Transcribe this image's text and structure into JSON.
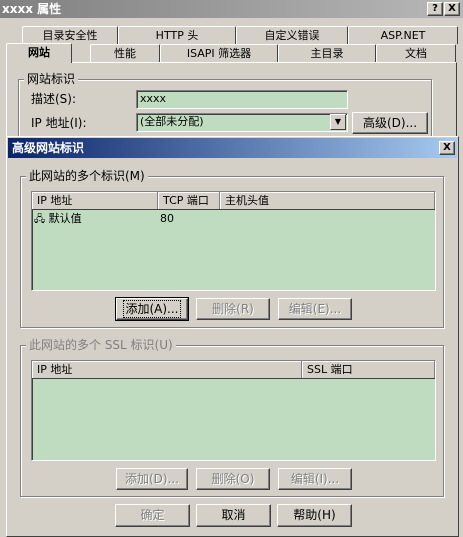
{
  "window": {
    "title": "xxxx 属性",
    "help_btn": "?",
    "close_btn": "X"
  },
  "tabs_row1": [
    "目录安全性",
    "HTTP 头",
    "自定义错误",
    "ASP.NET"
  ],
  "tabs_row2": [
    "网站",
    "性能",
    "ISAPI 筛选器",
    "主目录",
    "文档"
  ],
  "site_id": {
    "legend": "网站标识",
    "desc_label": "描述(S):",
    "desc_value": "xxxx",
    "ip_label": "IP 地址(I):",
    "ip_value": "(全部未分配)",
    "advanced_btn": "高级(D)..."
  },
  "dialog": {
    "title": "高级网站标识",
    "close_btn": "X",
    "multi": {
      "legend": "此网站的多个标识(M)",
      "columns": [
        "IP 地址",
        "TCP 端口",
        "主机头值"
      ],
      "rows": [
        {
          "ip": "默认值",
          "port": "80",
          "host": ""
        }
      ],
      "add_btn": "添加(A)...",
      "remove_btn": "删除(R)",
      "edit_btn": "编辑(E)..."
    },
    "ssl": {
      "legend": "此网站的多个 SSL 标识(U)",
      "columns": [
        "IP 地址",
        "SSL 端口"
      ],
      "add_btn": "添加(D)...",
      "remove_btn": "删除(O)",
      "edit_btn": "编辑(I)..."
    },
    "ok_btn": "确定",
    "cancel_btn": "取消",
    "help_btn": "帮助(H)"
  }
}
